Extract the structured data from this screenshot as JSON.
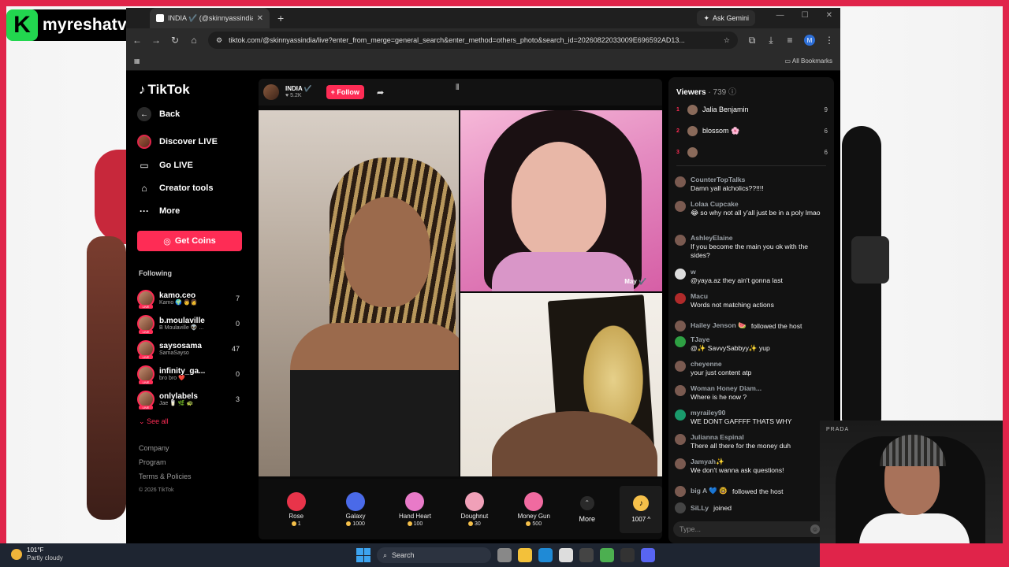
{
  "brand": {
    "logo_letter": "K",
    "name": "myreshatv"
  },
  "browser": {
    "tab_title": "INDIA ✔️ (@skinnyassindia)",
    "tab_close": "✕",
    "new_tab": "+",
    "ask_gemini": "Ask Gemini",
    "url": "tiktok.com/@skinnyassindia/live?enter_from_merge=general_search&enter_method=others_photo&search_id=20260822033009E696592AD13...",
    "profile_initial": "M",
    "bookmarks_label": "All Bookmarks"
  },
  "sidebar": {
    "logo": "TikTok",
    "back": "Back",
    "discover_live": "Discover LIVE",
    "go_live": "Go LIVE",
    "creator_tools": "Creator tools",
    "more": "More",
    "get_coins": "Get Coins",
    "following_title": "Following",
    "following": [
      {
        "name": "kamo.ceo",
        "sub": "Kamo 🌍 👨‍👩",
        "count": "7"
      },
      {
        "name": "b.moulaville",
        "sub": "B Moulaville 👽 ...",
        "count": "0"
      },
      {
        "name": "saysosama",
        "sub": "SamaSayso",
        "count": "47"
      },
      {
        "name": "infinity_ga...",
        "sub": "bro bro ❤️",
        "count": "0"
      },
      {
        "name": "onlylabels",
        "sub": "Jae 🥛 🌿 🐢",
        "count": "3"
      }
    ],
    "see_all": "See all",
    "company": "Company",
    "program": "Program",
    "terms": "Terms & Policies",
    "copyright": "© 2026 TikTok"
  },
  "live": {
    "host_name": "INDIA ✔️",
    "host_sub": "♥ 5.2K",
    "follow": "+ Follow",
    "guest_label": "May ✔️",
    "gifts": [
      {
        "name": "Rose",
        "price": "1",
        "color": "#e8344a"
      },
      {
        "name": "Galaxy",
        "price": "1000",
        "color": "#4a6ae8"
      },
      {
        "name": "Hand Heart",
        "price": "100",
        "color": "#e87ac8"
      },
      {
        "name": "Doughnut",
        "price": "30",
        "color": "#f0a0b8"
      },
      {
        "name": "Money Gun",
        "price": "500",
        "color": "#f06aa0"
      }
    ],
    "more": "More",
    "balance": "1007 ^"
  },
  "chat": {
    "viewers_label": "Viewers",
    "viewers_count": "· 739",
    "viewers": [
      {
        "rank": "1",
        "name": "Jalia Benjamin",
        "score": "9"
      },
      {
        "rank": "2",
        "name": "blossom 🌸",
        "score": "6"
      },
      {
        "rank": "3",
        "name": "",
        "score": "6"
      }
    ],
    "messages": [
      {
        "user": "CounterTopTalks",
        "text": "Damn yall alcholics??!!!!"
      },
      {
        "user": "Lolaa Cupcake",
        "text": "😂 so why not all y'all just be in a poly lmao"
      },
      {
        "user": "AshleyElaine",
        "text": "If you become the main you ok with the sides?"
      },
      {
        "user": "w",
        "text": "@yaya.az they ain't gonna last"
      },
      {
        "user": "Macu",
        "text": "Words not matching actions"
      },
      {
        "user": "Hailey Jenson 🍉",
        "text": "followed the host",
        "inline": true
      },
      {
        "user": "TJaye",
        "text": "@✨ SavvySabbyy✨ yup"
      },
      {
        "user": "cheyenne",
        "text": "your just content atp"
      },
      {
        "user": "Woman Honey Diam...",
        "text": "Where is he now ?"
      },
      {
        "user": "myrailey90",
        "text": "WE DONT GAFFFF THATS WHY"
      },
      {
        "user": "Julianna Espinal",
        "text": "There all there for the money duh"
      },
      {
        "user": "Jamyah✨",
        "text": "We don't wanna ask questions!"
      },
      {
        "user": "big A 💙 🤓",
        "text": "followed the host",
        "inline": true
      },
      {
        "user": "SiLLy",
        "text": "joined",
        "inline": true
      }
    ],
    "input_placeholder": "Type..."
  },
  "webcam": {
    "backdrop_text": "PRADA"
  },
  "taskbar": {
    "temp": "101°F",
    "condition": "Partly cloudy",
    "search": "Search"
  }
}
